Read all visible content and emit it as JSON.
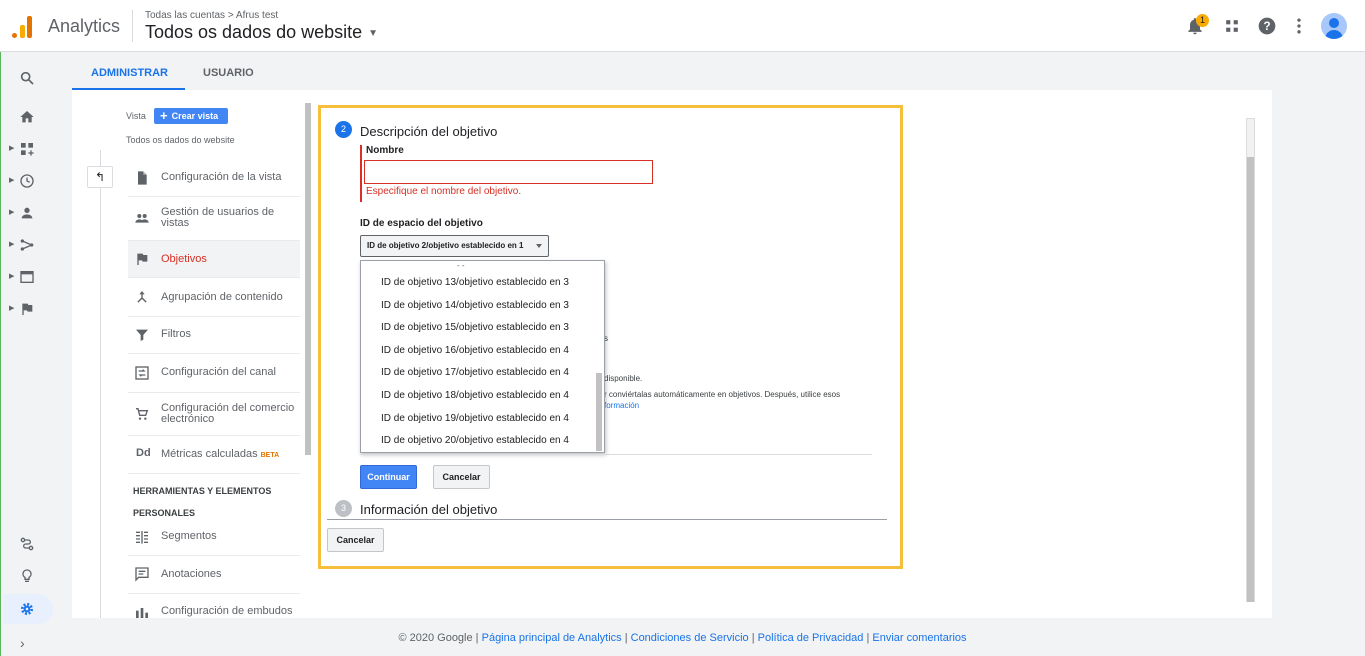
{
  "header": {
    "app_name": "Analytics",
    "breadcrumb_account": "Todas las cuentas",
    "breadcrumb_property": "Afrus test",
    "breadcrumb_sep": ">",
    "view_title": "Todos os dados do website",
    "notification_count": "1",
    "icons": [
      "bell-icon",
      "apps-icon",
      "help-icon",
      "more-vert-icon",
      "account-avatar"
    ]
  },
  "leftnav": {
    "icons": [
      "search-icon",
      "home-icon",
      "customization-icon",
      "realtime-icon",
      "audience-icon",
      "acquisition-icon",
      "behavior-icon",
      "conversions-icon",
      "attribution-icon",
      "discover-icon",
      "admin-gear-icon",
      "collapse-icon"
    ]
  },
  "tabs": {
    "admin": "ADMINISTRAR",
    "user": "USUARIO"
  },
  "view_column": {
    "vista_label": "Vista",
    "create_view_button": "Crear vista",
    "view_name": "Todos os dados do website",
    "back_icon": "↰",
    "items": [
      {
        "label": "Configuración de la vista"
      },
      {
        "label": "Gestión de usuarios de vistas"
      },
      {
        "label": "Objetivos"
      },
      {
        "label": "Agrupación de contenido"
      },
      {
        "label": "Filtros"
      },
      {
        "label": "Configuración del canal"
      },
      {
        "label": "Configuración del comercio electrónico"
      },
      {
        "label": "Métricas calculadas",
        "badge": "BETA"
      }
    ],
    "tools_header_1": "HERRAMIENTAS Y ELEMENTOS",
    "tools_header_2": "PERSONALES",
    "tool_items": [
      {
        "label": "Segmentos"
      },
      {
        "label": "Anotaciones"
      },
      {
        "label": "Configuración de embudos"
      }
    ]
  },
  "goal_form": {
    "step2_number": "2",
    "step2_title": "Descripción del objetivo",
    "name_label": "Nombre",
    "name_value": "",
    "name_error": "Especifique el nombre del objetivo.",
    "slot_label": "ID de espacio del objetivo",
    "slot_selected": "ID de objetivo 2/objetivo establecido en 1",
    "dropdown_options": [
      "ID de objetivo 13/objetivo establecido en 3",
      "ID de objetivo 14/objetivo establecido en 3",
      "ID de objetivo 15/objetivo establecido en 3",
      "ID de objetivo 16/objetivo establecido en 4",
      "ID de objetivo 17/objetivo establecido en 4",
      "ID de objetivo 18/objetivo establecido en 4",
      "ID de objetivo 19/objetivo establecido en 4",
      "ID de objetivo 20/objetivo establecido en 4"
    ],
    "bg_fragment_1": "s",
    "bg_fragment_2": "disponible.",
    "bg_fragment_3": "r conviértalas automáticamente en objetivos. Después, utilice esos",
    "bg_fragment_link": "formación",
    "continue_button": "Continuar",
    "cancel_step_button": "Cancelar",
    "step3_number": "3",
    "step3_title": "Información del objetivo",
    "cancel_button": "Cancelar"
  },
  "footer": {
    "copyright": "© 2020 Google",
    "sep": " | ",
    "links": [
      "Página principal de Analytics",
      "Condiciones de Servicio",
      "Política de Privacidad",
      "Enviar comentarios"
    ]
  },
  "colors": {
    "accent": "#1a73e8",
    "error": "#d93025",
    "highlight_frame": "#f6bf3b",
    "button_blue": "#4285f4"
  }
}
